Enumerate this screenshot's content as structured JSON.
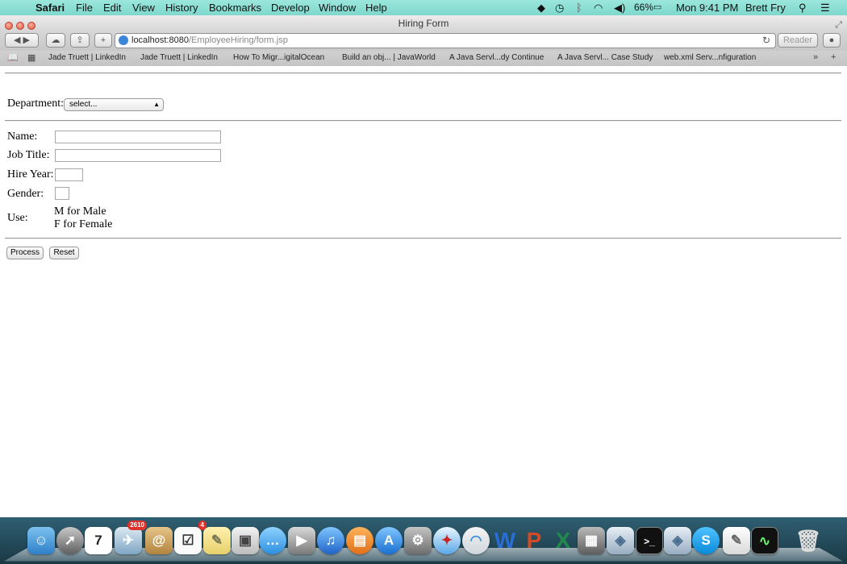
{
  "menubar": {
    "app_name": "Safari",
    "menus": [
      "File",
      "Edit",
      "View",
      "History",
      "Bookmarks",
      "Develop",
      "Window",
      "Help"
    ],
    "battery": "66%",
    "clock": "Mon 9:41 PM",
    "user": "Brett Fry",
    "icons": [
      "apple-icon",
      "dropbox-icon",
      "time-machine-icon",
      "bluetooth-icon",
      "wifi-icon",
      "volume-icon",
      "battery-icon",
      "spotlight-icon",
      "notification-center-icon"
    ]
  },
  "window": {
    "title": "Hiring Form",
    "url_host": "localhost:8080",
    "url_path": "/EmployeeHiring/form.jsp",
    "reader_label": "Reader"
  },
  "bookmarks": [
    "Jade Truett | LinkedIn",
    "Jade Truett | LinkedIn",
    "How To Migr...igitalOcean",
    "Build an obj... | JavaWorld",
    "A Java Servl...dy Continue",
    "A Java Servl... Case Study",
    "web.xml Serv...nfiguration"
  ],
  "form": {
    "department_label": "Department:",
    "department_selected": "select...",
    "name_label": "Name:",
    "job_title_label": "Job Title:",
    "hire_year_label": "Hire Year:",
    "gender_label": "Gender:",
    "use_label": "Use:",
    "gender_hint_m": "M for Male",
    "gender_hint_f": "F for Female",
    "process_button": "Process",
    "reset_button": "Reset"
  },
  "dock": {
    "icons": [
      "finder-icon",
      "launchpad-icon",
      "calendar-icon",
      "mail-icon",
      "contacts-icon",
      "reminders-icon",
      "notes-icon",
      "preview-icon",
      "messages-icon",
      "facetime-icon",
      "itunes-icon",
      "ibooks-icon",
      "app-store-icon",
      "system-preferences-icon",
      "safari-icon",
      "network-icon",
      "word-icon",
      "powerpoint-icon",
      "excel-icon",
      "calculator-icon",
      "virtualbox-icon",
      "terminal-icon",
      "virtualbox-icon-2",
      "skype-icon",
      "textedit-icon",
      "activity-monitor-icon",
      "trash-icon"
    ],
    "calendar_day": "7",
    "mail_badge": "2610",
    "reminders_badge": "4"
  }
}
